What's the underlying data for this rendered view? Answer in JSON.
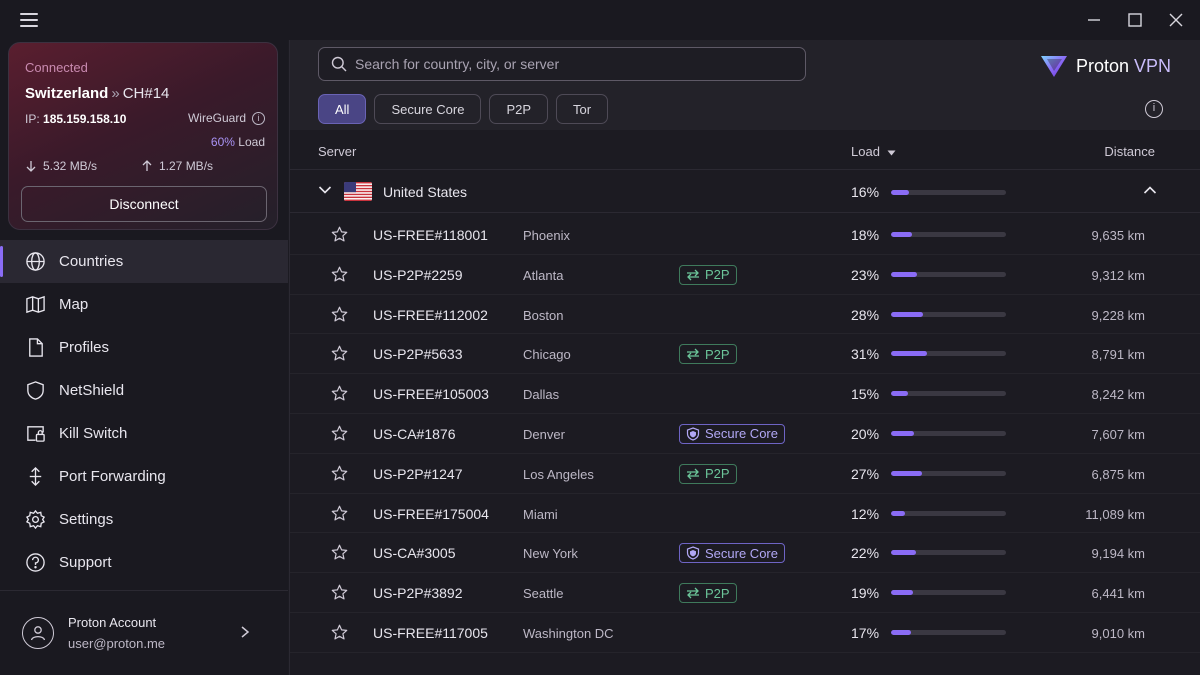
{
  "connection": {
    "status": "Connected",
    "country": "Switzerland",
    "separator": "»",
    "server": "CH#14",
    "ip_label": "IP:",
    "ip": "185.159.158.10",
    "protocol": "WireGuard",
    "load_pct": "60%",
    "load_label": "Load",
    "download": "5.32 MB/s",
    "upload": "1.27 MB/s",
    "disconnect_label": "Disconnect"
  },
  "nav": {
    "items": [
      {
        "label": "Countries",
        "icon": "globe-icon",
        "active": true
      },
      {
        "label": "Map",
        "icon": "map-icon"
      },
      {
        "label": "Profiles",
        "icon": "document-icon"
      },
      {
        "label": "NetShield",
        "icon": "shield-icon"
      },
      {
        "label": "Kill Switch",
        "icon": "kill-switch-icon"
      },
      {
        "label": "Port Forwarding",
        "icon": "port-forwarding-icon"
      },
      {
        "label": "Settings",
        "icon": "gear-icon"
      },
      {
        "label": "Support",
        "icon": "help-icon"
      }
    ]
  },
  "account": {
    "name": "Proton Account",
    "email": "user@proton.me"
  },
  "search": {
    "placeholder": "Search for country, city, or server"
  },
  "brand": {
    "name": "Proton",
    "product": "VPN"
  },
  "filters": [
    "All",
    "Secure Core",
    "P2P",
    "Tor"
  ],
  "columns": {
    "server": "Server",
    "load": "Load",
    "distance": "Distance"
  },
  "country": {
    "name": "United States",
    "load": "16%",
    "load_value": 16
  },
  "servers": [
    {
      "name": "US-FREE#118001",
      "city": "Phoenix",
      "feature": "",
      "load": "18%",
      "load_value": 18,
      "distance": "9,635 km"
    },
    {
      "name": "US-P2P#2259",
      "city": "Atlanta",
      "feature": "P2P",
      "load": "23%",
      "load_value": 23,
      "distance": "9,312 km"
    },
    {
      "name": "US-FREE#112002",
      "city": "Boston",
      "feature": "",
      "load": "28%",
      "load_value": 28,
      "distance": "9,228 km"
    },
    {
      "name": "US-P2P#5633",
      "city": "Chicago",
      "feature": "P2P",
      "load": "31%",
      "load_value": 31,
      "distance": "8,791 km"
    },
    {
      "name": "US-FREE#105003",
      "city": "Dallas",
      "feature": "",
      "load": "15%",
      "load_value": 15,
      "distance": "8,242 km"
    },
    {
      "name": "US-CA#1876",
      "city": "Denver",
      "feature": "Secure Core",
      "load": "20%",
      "load_value": 20,
      "distance": "7,607 km"
    },
    {
      "name": "US-P2P#1247",
      "city": "Los Angeles",
      "feature": "P2P",
      "load": "27%",
      "load_value": 27,
      "distance": "6,875 km"
    },
    {
      "name": "US-FREE#175004",
      "city": "Miami",
      "feature": "",
      "load": "12%",
      "load_value": 12,
      "distance": "11,089 km"
    },
    {
      "name": "US-CA#3005",
      "city": "New York",
      "feature": "Secure Core",
      "load": "22%",
      "load_value": 22,
      "distance": "9,194 km"
    },
    {
      "name": "US-P2P#3892",
      "city": "Seattle",
      "feature": "P2P",
      "load": "19%",
      "load_value": 19,
      "distance": "6,441 km"
    },
    {
      "name": "US-FREE#117005",
      "city": "Washington DC",
      "feature": "",
      "load": "17%",
      "load_value": 17,
      "distance": "9,010 km"
    }
  ],
  "colors": {
    "accent": "#8a6cf5",
    "p2p": "#6cc59a",
    "secure_core": "#b2a8f5",
    "connected": "#c98ab0"
  }
}
